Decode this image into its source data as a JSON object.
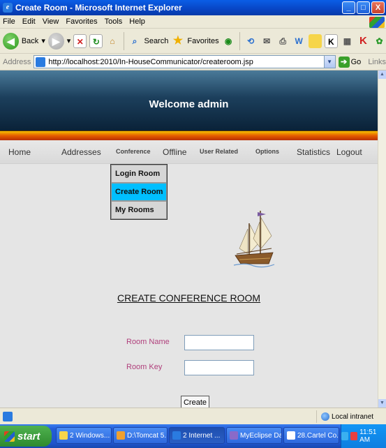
{
  "window": {
    "title": "Create Room - Microsoft Internet Explorer",
    "buttons": {
      "minimize": "_",
      "maximize": "□",
      "close": "X"
    }
  },
  "menu": [
    "File",
    "Edit",
    "View",
    "Favorites",
    "Tools",
    "Help"
  ],
  "toolbar": {
    "back_label": "Back",
    "search_label": "Search",
    "favorites_label": "Favorites"
  },
  "address": {
    "label": "Address",
    "url": "http://localhost:2010/In-HouseCommunicator/createroom.jsp",
    "go_label": "Go",
    "links_label": "Links"
  },
  "page": {
    "welcome": "Welcome admin",
    "nav": {
      "home": "Home",
      "addresses": "Addresses",
      "conference": "Conference",
      "offline": "Offline",
      "user_related": "User Related",
      "options": "Options",
      "statistics": "Statistics",
      "logout": "Logout"
    },
    "submenu": [
      "Login Room",
      "Create Room",
      "My Rooms"
    ],
    "submenu_active": "Create Room",
    "heading": "CREATE CONFERENCE ROOM",
    "form": {
      "room_name_label": "Room Name",
      "room_name_value": "",
      "room_key_label": "Room Key",
      "room_key_value": "",
      "create_label": "Create"
    }
  },
  "status": {
    "zone": "Local intranet"
  },
  "taskbar": {
    "start_label": "start",
    "tasks": [
      "2 Windows...",
      "D:\\Tomcat 5...",
      "2 Internet ...",
      "MyEclipse Da...",
      "28.Cartel Co..."
    ],
    "clock": "11:51 AM"
  },
  "colors": {
    "banner_dark": "#0a2238",
    "stripe_orange": "#e65c00",
    "submenu_active": "#00bfff",
    "form_label": "#b0407c",
    "xp_blue": "#245dd8",
    "start_green": "#2e8a2e"
  }
}
